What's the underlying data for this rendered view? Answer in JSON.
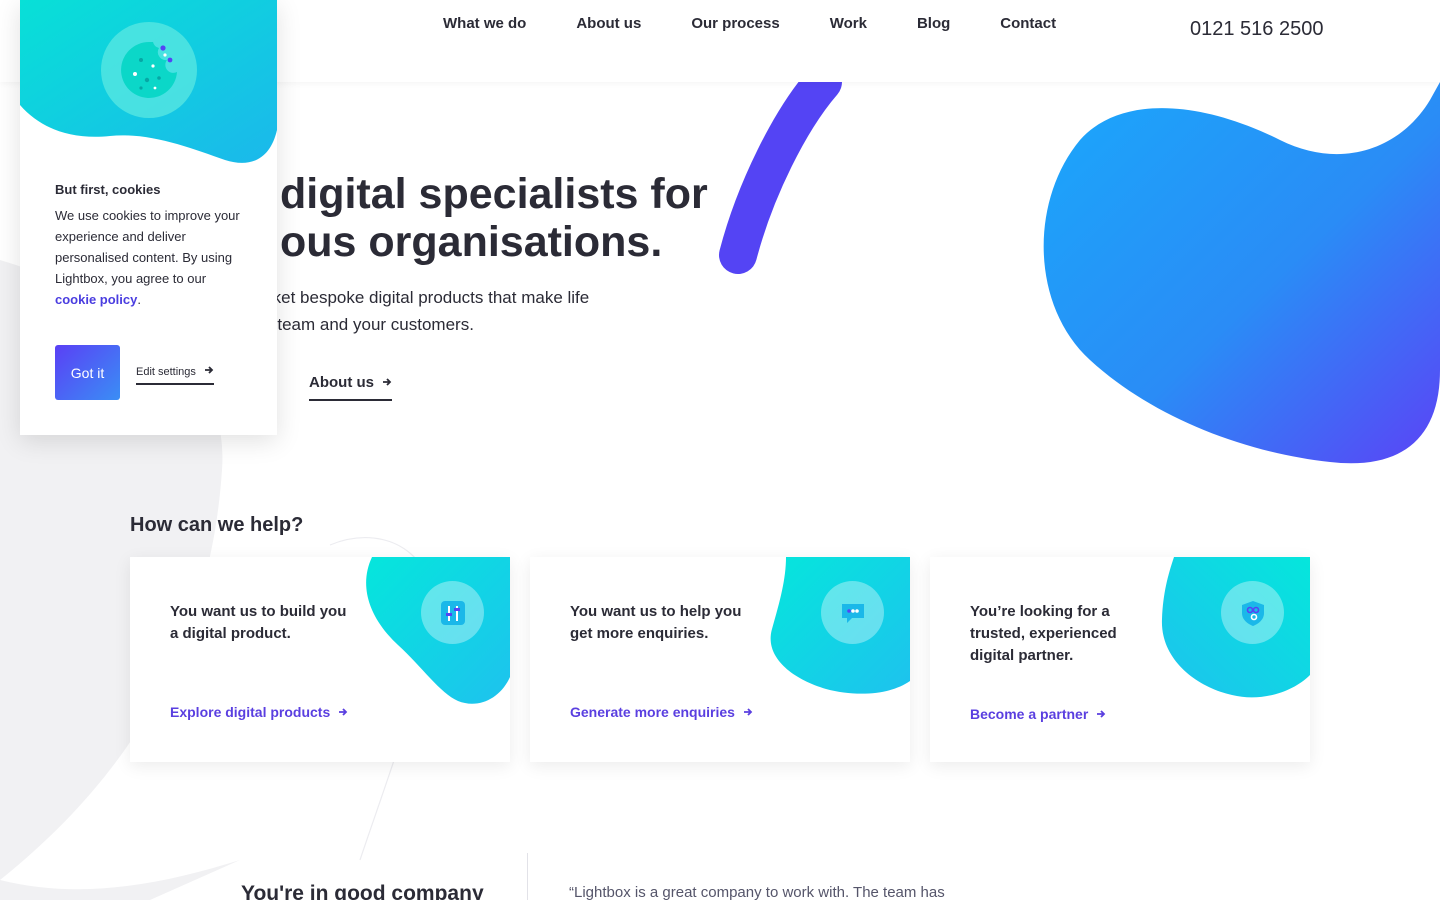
{
  "nav": {
    "items": [
      "What we do",
      "About us",
      "Our process",
      "Work",
      "Blog",
      "Contact"
    ],
    "phone": "0121 516 2500"
  },
  "hero": {
    "title_line1": "digital specialists for",
    "title_line2": "ous organisations.",
    "subtitle_line1": "rket bespoke digital products that make life",
    "subtitle_line2": "r team and your customers.",
    "about_link": "About us"
  },
  "cookie": {
    "title": "But first, cookies",
    "text": "We use cookies to improve your experience and deliver personalised content. By using Lightbox, you agree to our",
    "link": "cookie policy",
    "text_end": ".",
    "accept": "Got it",
    "settings": "Edit settings"
  },
  "help": {
    "heading": "How can we help?",
    "cards": [
      {
        "text": "You want us to build you a digital product.",
        "link": "Explore digital products",
        "icon": "sliders-icon"
      },
      {
        "text": "You want us to help you get more enquiries.",
        "link": "Generate more enquiries",
        "icon": "chat-icon"
      },
      {
        "text": "You’re looking for a trusted, experienced digital partner.",
        "link": "Become a partner",
        "icon": "shield-icon"
      }
    ]
  },
  "bottom": {
    "company_heading": "You're in good company",
    "quote": "“Lightbox is a great company to work with. The team has"
  },
  "colors": {
    "accent": "#5a3fe0",
    "teal": "#0fd6d9",
    "blue": "#1ea6f5",
    "purple": "#5b43f6",
    "text": "#2b2b36"
  }
}
